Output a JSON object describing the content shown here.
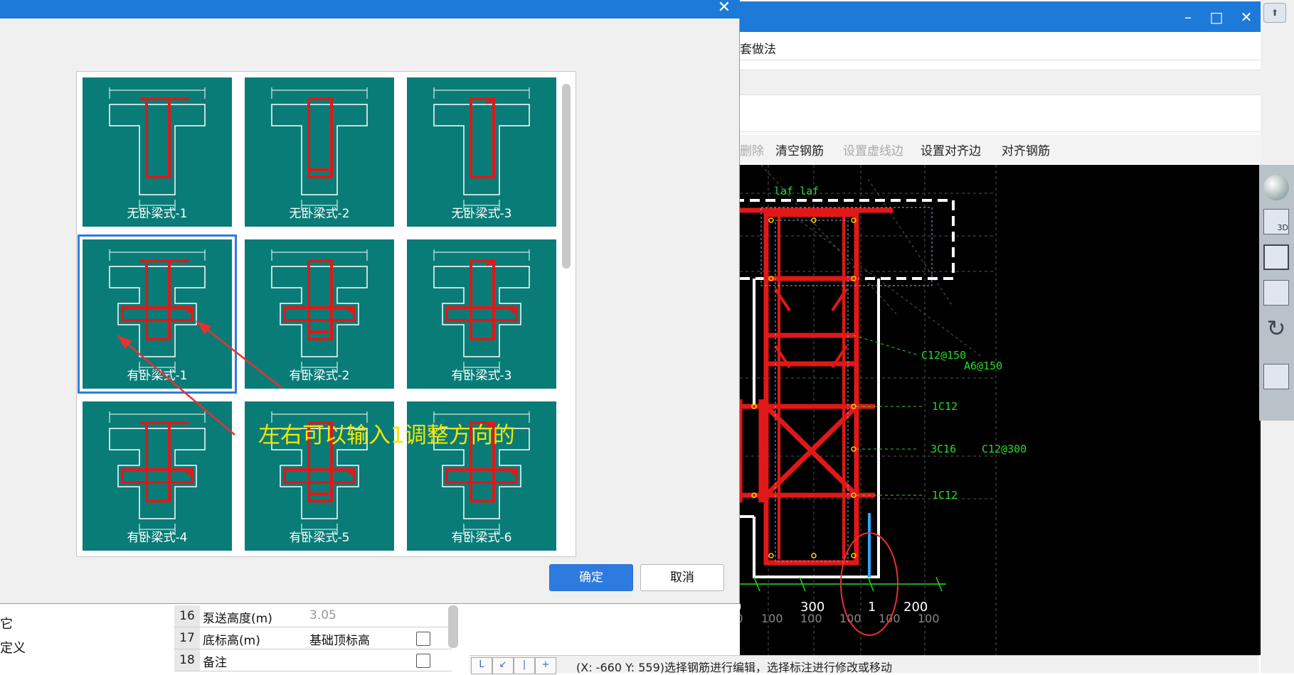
{
  "dialog": {
    "close_glyph": "✕",
    "options": [
      {
        "label": "无卧梁式-1",
        "selected": false
      },
      {
        "label": "无卧梁式-2",
        "selected": false
      },
      {
        "label": "无卧梁式-3",
        "selected": false
      },
      {
        "label": "有卧梁式-1",
        "selected": true
      },
      {
        "label": "有卧梁式-2",
        "selected": false
      },
      {
        "label": "有卧梁式-3",
        "selected": false
      },
      {
        "label": "有卧梁式-4",
        "selected": false
      },
      {
        "label": "有卧梁式-5",
        "selected": false
      },
      {
        "label": "有卧梁式-6",
        "selected": false
      }
    ],
    "ok_label": "确定",
    "cancel_label": "取消",
    "annotation": "左右可以输入1调整方向的",
    "annotation_color": "#f5e600",
    "arrow_color": "#e8312f"
  },
  "app_window": {
    "minimize_glyph": "–",
    "maximize_glyph": "□",
    "close_glyph": "✕",
    "menu_partial": "套做法",
    "toolbar": [
      "删除",
      "清空钢筋",
      "设置虚线边",
      "设置对齐边",
      "对齐钢筋"
    ],
    "toolbar_disabled": [
      true,
      false,
      true,
      false,
      false
    ],
    "canvas": {
      "labels": {
        "laf": "laf  laf",
        "stirrup1": "C12@150",
        "stirrup2": "A6@150",
        "bar1": "1C12",
        "bar2": "3C16",
        "bar3": "C12@300",
        "bar4": "1C12"
      },
      "dims": [
        "200",
        "100",
        "300",
        "1",
        "200"
      ],
      "grid_ticks": [
        "100",
        "100",
        "100",
        "100",
        "100",
        "100",
        "100",
        "100",
        "100"
      ],
      "rebar_color": "#e01818",
      "label_color": "#22dd22"
    },
    "right_tools": [
      "sphere",
      "3D",
      "box-front",
      "box",
      "rotate",
      "list"
    ]
  },
  "properties": {
    "left_labels": [
      "它",
      "定义"
    ],
    "rows": [
      {
        "num": "16",
        "name": "泵送高度(m)",
        "value": "3.05",
        "muted": true,
        "checkbox": false
      },
      {
        "num": "17",
        "name": "底标高(m)",
        "value": "基础顶标高",
        "muted": false,
        "checkbox": true
      },
      {
        "num": "18",
        "name": "备注",
        "value": "",
        "muted": false,
        "checkbox": true
      }
    ]
  },
  "status": {
    "buttons": [
      "L",
      "↙",
      "|",
      "+"
    ],
    "text": "(X: -660 Y: 559)选择钢筋进行编辑，选择标注进行修改或移动"
  }
}
